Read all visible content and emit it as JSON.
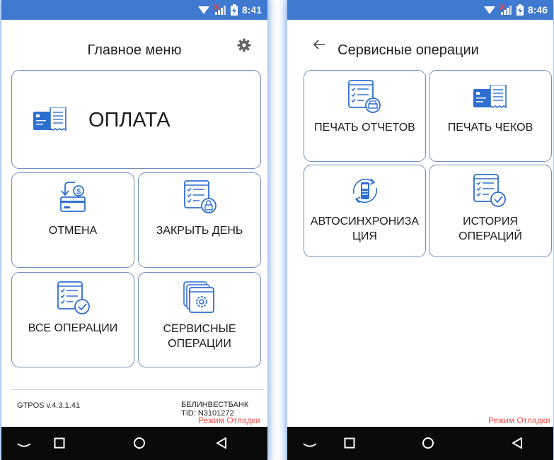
{
  "status_left": {
    "time": "8:41"
  },
  "status_right": {
    "time": "8:46"
  },
  "main_menu": {
    "title": "Главное меню",
    "pay_label": "ОПЛАТА",
    "cancel_label": "ОТМЕНА",
    "close_day_label": "ЗАКРЫТЬ ДЕНЬ",
    "all_ops_label": "ВСЕ ОПЕРАЦИИ",
    "service_ops_line1": "СЕРВИСНЫЕ",
    "service_ops_line2": "ОПЕРАЦИИ",
    "version": "GTPOS v.4.3.1.41",
    "bank": "БЕЛИНВЕСТБАНК",
    "tid": "TID: N3101272",
    "debug_mode": "Режим Отладки"
  },
  "service_menu": {
    "title": "Сервисные операции",
    "print_reports_label": "ПЕЧАТЬ ОТЧЕТОВ",
    "print_receipts_label": "ПЕЧАТЬ ЧЕКОВ",
    "autosync_line1": "АВТОСИНХРОНИЗА",
    "autosync_line2": "ЦИЯ",
    "history_line1": "ИСТОРИЯ",
    "history_line2": "ОПЕРАЦИЙ",
    "debug_mode": "Режим Отладки"
  },
  "colors": {
    "accent": "#3f79d0",
    "icon_blue": "#2f6fd0",
    "tile_border": "#6f8fb8",
    "debug_red": "#ff4d4d"
  }
}
